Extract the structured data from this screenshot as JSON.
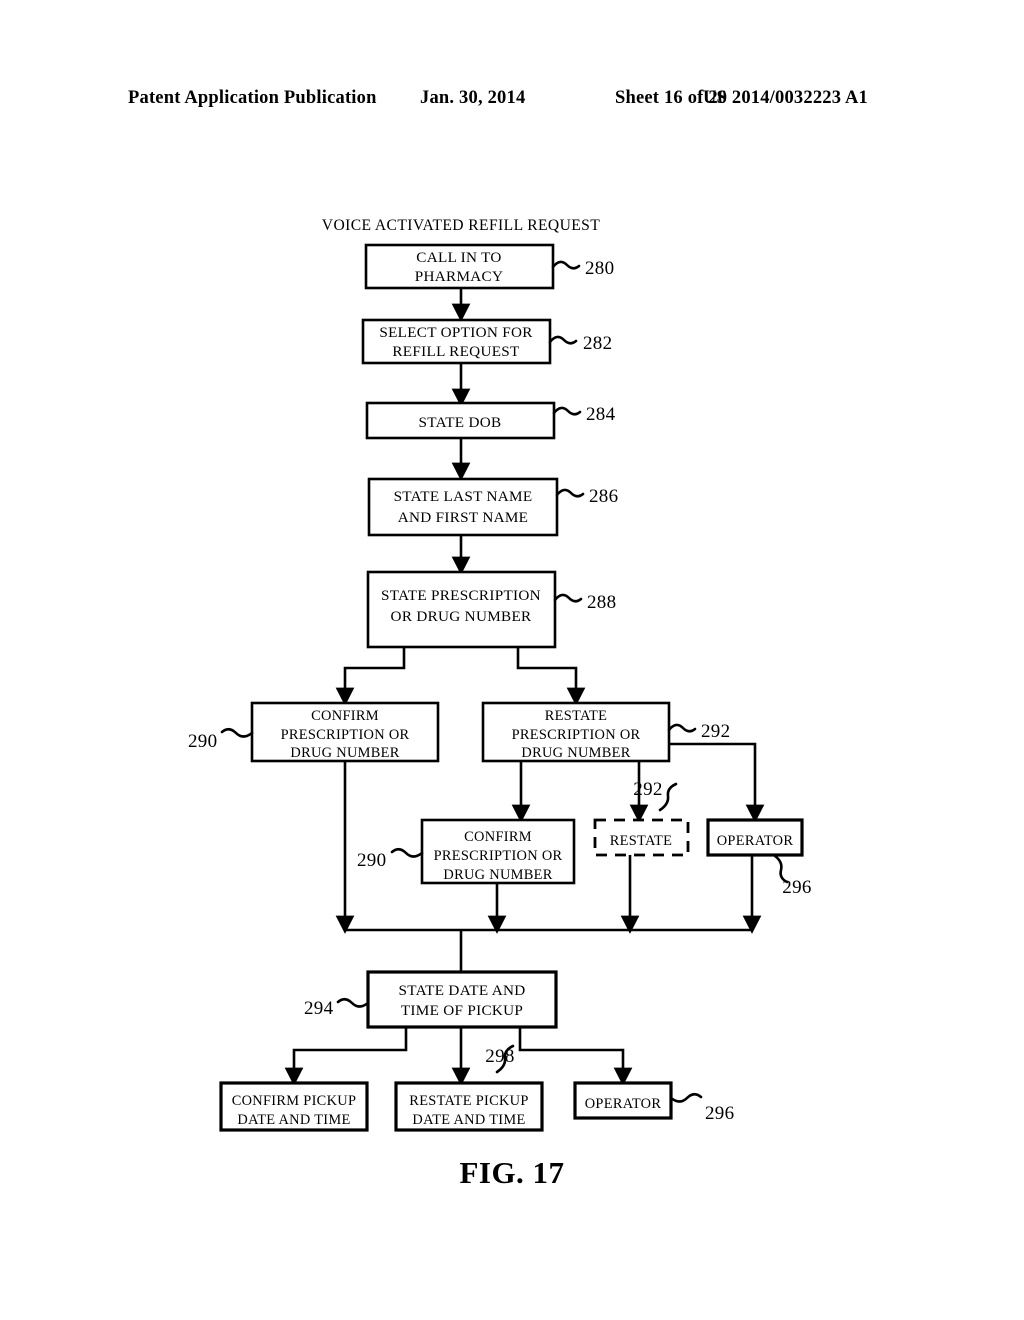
{
  "header": {
    "publication": "Patent Application Publication",
    "date": "Jan. 30, 2014",
    "sheet": "Sheet 16 of 20",
    "patent_number": "US 2014/0032223 A1"
  },
  "figure": {
    "caption": "FIG. 17",
    "title": "VOICE ACTIVATED REFILL REQUEST",
    "type": "flowchart"
  },
  "nodes": [
    {
      "id": "n280",
      "ref": "280",
      "lines": [
        "CALL IN TO",
        "PHARMACY"
      ],
      "style": "solid"
    },
    {
      "id": "n282",
      "ref": "282",
      "lines": [
        "SELECT OPTION FOR",
        "REFILL REQUEST"
      ],
      "style": "solid"
    },
    {
      "id": "n284",
      "ref": "284",
      "lines": [
        "STATE DOB"
      ],
      "style": "solid"
    },
    {
      "id": "n286",
      "ref": "286",
      "lines": [
        "STATE LAST NAME",
        "AND FIRST NAME"
      ],
      "style": "solid"
    },
    {
      "id": "n288",
      "ref": "288",
      "lines": [
        "STATE PRESCRIPTION",
        "OR DRUG NUMBER"
      ],
      "style": "solid"
    },
    {
      "id": "n290a",
      "ref": "290",
      "lines": [
        "CONFIRM",
        "PRESCRIPTION OR",
        "DRUG NUMBER"
      ],
      "style": "solid"
    },
    {
      "id": "n292a",
      "ref": "292",
      "lines": [
        "RESTATE",
        "PRESCRIPTION OR",
        "DRUG NUMBER"
      ],
      "style": "solid"
    },
    {
      "id": "n290b",
      "ref": "290",
      "lines": [
        "CONFIRM",
        "PRESCRIPTION OR",
        "DRUG NUMBER"
      ],
      "style": "solid"
    },
    {
      "id": "n292b",
      "ref": "292",
      "lines": [
        "RESTATE"
      ],
      "style": "dashed"
    },
    {
      "id": "n296a",
      "ref": "296",
      "lines": [
        "OPERATOR"
      ],
      "style": "solid"
    },
    {
      "id": "n294",
      "ref": "294",
      "lines": [
        "STATE DATE AND",
        "TIME OF PICKUP"
      ],
      "style": "solid"
    },
    {
      "id": "n_confirm_pickup",
      "ref": "",
      "lines": [
        "CONFIRM PICKUP",
        "DATE AND TIME"
      ],
      "style": "solid"
    },
    {
      "id": "n298",
      "ref": "298",
      "lines": [
        "RESTATE PICKUP",
        "DATE AND TIME"
      ],
      "style": "solid"
    },
    {
      "id": "n296b",
      "ref": "296",
      "lines": [
        "OPERATOR"
      ],
      "style": "solid"
    }
  ],
  "reference_numerals": [
    "280",
    "282",
    "284",
    "286",
    "288",
    "290",
    "292",
    "290",
    "292",
    "296",
    "294",
    "298",
    "296"
  ],
  "colors": {
    "ink": "#000000",
    "paper": "#ffffff"
  }
}
